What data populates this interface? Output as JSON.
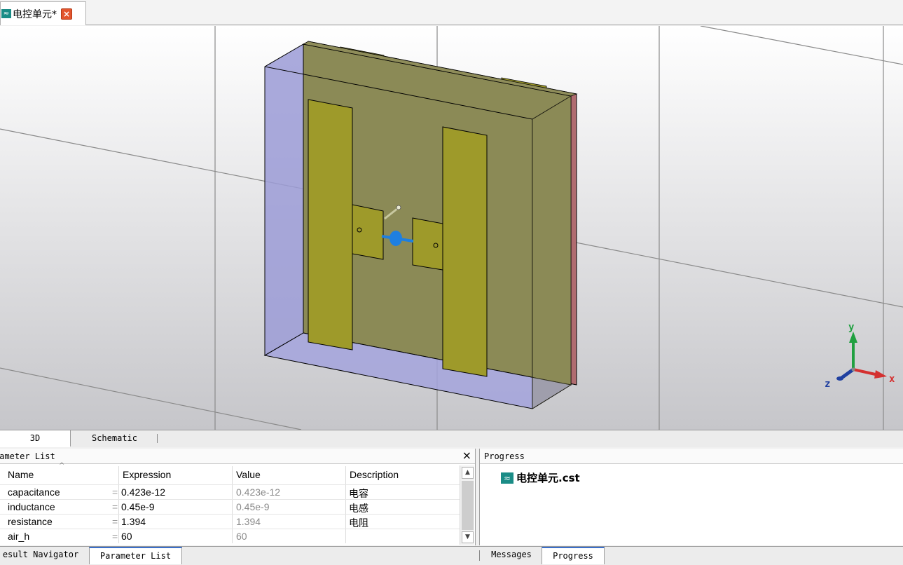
{
  "document_tab": {
    "title": "电控单元*",
    "icon": "cst-wave-icon",
    "close_icon": "close-x-icon"
  },
  "viewport": {
    "axes": {
      "y_label": "y",
      "x_label": "x",
      "z_label": "z"
    },
    "colors": {
      "background_top": "#ffffff",
      "background_bottom": "#c8c8cc",
      "substrate": "#8b8a56",
      "patch": "#9e9a2a",
      "air_box": "#9b9bd6",
      "ground": "#b06c70",
      "port": "#1e7fe0"
    }
  },
  "view_tabs": {
    "tab_3d": "3D",
    "tab_schematic": "Schematic"
  },
  "parameter_list": {
    "title": "rameter List",
    "columns": {
      "name": "Name",
      "expression": "Expression",
      "value": "Value",
      "description": "Description"
    },
    "rows": [
      {
        "name": "capacitance",
        "eq": "=",
        "expression": "0.423e-12",
        "value": "0.423e-12",
        "description": "电容"
      },
      {
        "name": "inductance",
        "eq": "=",
        "expression": "0.45e-9",
        "value": "0.45e-9",
        "description": "电感"
      },
      {
        "name": "resistance",
        "eq": "=",
        "expression": "1.394",
        "value": "1.394",
        "description": "电阻"
      },
      {
        "name": "air_h",
        "eq": "=",
        "expression": "60",
        "value": "60",
        "description": ""
      }
    ],
    "close_label": "×"
  },
  "progress": {
    "title": "Progress",
    "file": "电控单元.cst"
  },
  "bottom_tabs": {
    "result_navigator": "esult Navigator",
    "parameter_list": "Parameter List",
    "messages": "Messages",
    "progress": "Progress"
  }
}
